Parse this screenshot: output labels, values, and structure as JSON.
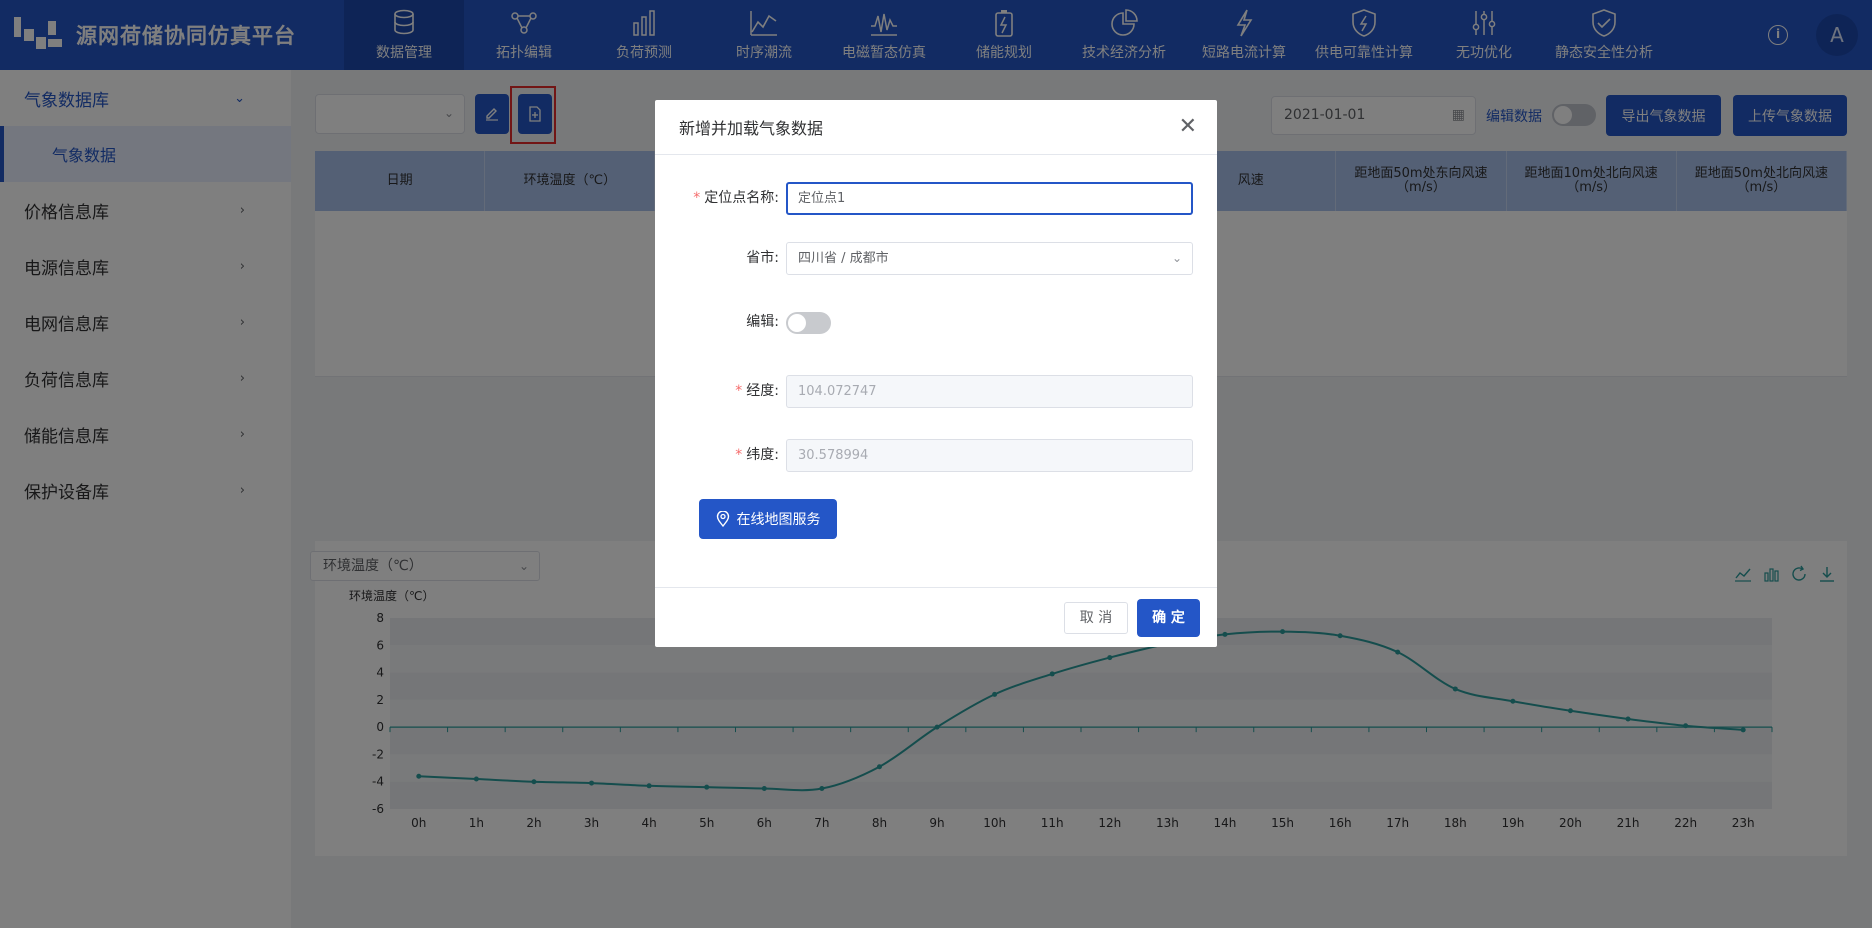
{
  "app": {
    "title": "源网荷储协同仿真平台"
  },
  "nav": [
    {
      "label": "数据管理",
      "icon": "database-icon",
      "active": true
    },
    {
      "label": "拓扑编辑",
      "icon": "topology-icon"
    },
    {
      "label": "负荷预测",
      "icon": "bar-chart-icon"
    },
    {
      "label": "时序潮流",
      "icon": "line-chart-icon"
    },
    {
      "label": "电磁暂态仿真",
      "icon": "waveform-icon"
    },
    {
      "label": "储能规划",
      "icon": "battery-icon"
    },
    {
      "label": "技术经济分析",
      "icon": "pie-chart-icon"
    },
    {
      "label": "短路电流计算",
      "icon": "lightning-icon"
    },
    {
      "label": "供电可靠性计算",
      "icon": "shield-bolt-icon"
    },
    {
      "label": "无功优化",
      "icon": "sliders-icon"
    },
    {
      "label": "静态安全性分析",
      "icon": "shield-check-icon"
    }
  ],
  "user": {
    "avatar": "A",
    "info": "i"
  },
  "sidebar": {
    "groups": [
      {
        "label": "气象数据库",
        "open": true,
        "children": [
          "气象数据"
        ]
      },
      {
        "label": "价格信息库"
      },
      {
        "label": "电源信息库"
      },
      {
        "label": "电网信息库"
      },
      {
        "label": "负荷信息库"
      },
      {
        "label": "储能信息库"
      },
      {
        "label": "保护设备库"
      }
    ]
  },
  "toolbar": {
    "date": "2021-01-01",
    "edit_label": "编辑数据",
    "export_label": "导出气象数据",
    "upload_label": "上传气象数据"
  },
  "table": {
    "headers": [
      "日期",
      "环境温度（℃）",
      "",
      "",
      "",
      "风速",
      "距地面50m处东向风速（m/s）",
      "距地面10m处北向风速（m/s）",
      "距地面50m处北向风速（m/s）"
    ]
  },
  "chart_select": "环境温度（℃）",
  "chart_data": {
    "type": "line",
    "ylabel": "环境温度（℃）",
    "ylim": [
      -6,
      8
    ],
    "yticks": [
      "8",
      "6",
      "4",
      "2",
      "0",
      "-2",
      "-4",
      "-6"
    ],
    "categories": [
      "0h",
      "1h",
      "2h",
      "3h",
      "4h",
      "5h",
      "6h",
      "7h",
      "8h",
      "9h",
      "10h",
      "11h",
      "12h",
      "13h",
      "14h",
      "15h",
      "16h",
      "17h",
      "18h",
      "19h",
      "20h",
      "21h",
      "22h",
      "23h"
    ],
    "values": [
      -3.6,
      -3.8,
      -4.0,
      -4.1,
      -4.3,
      -4.4,
      -4.5,
      -4.5,
      -2.9,
      0.0,
      2.4,
      3.9,
      5.1,
      6.1,
      6.8,
      7.0,
      6.7,
      5.5,
      2.8,
      1.9,
      1.2,
      0.6,
      0.1,
      -0.2
    ],
    "color": "#2a9b9b"
  },
  "dialog": {
    "title": "新增并加载气象数据",
    "fields": {
      "name_label": "定位点名称:",
      "name_value": "定位点1",
      "city_label": "省市:",
      "city_value": "四川省 / 成都市",
      "edit_label": "编辑:",
      "lng_label": "经度:",
      "lng_value": "104.072747",
      "lat_label": "纬度:",
      "lat_value": "30.578994"
    },
    "map_button": "在线地图服务",
    "cancel": "取 消",
    "ok": "确 定"
  },
  "colors": {
    "primary": "#2456c7",
    "highlight": "#e52b2b",
    "series": "#2a9b9b"
  }
}
